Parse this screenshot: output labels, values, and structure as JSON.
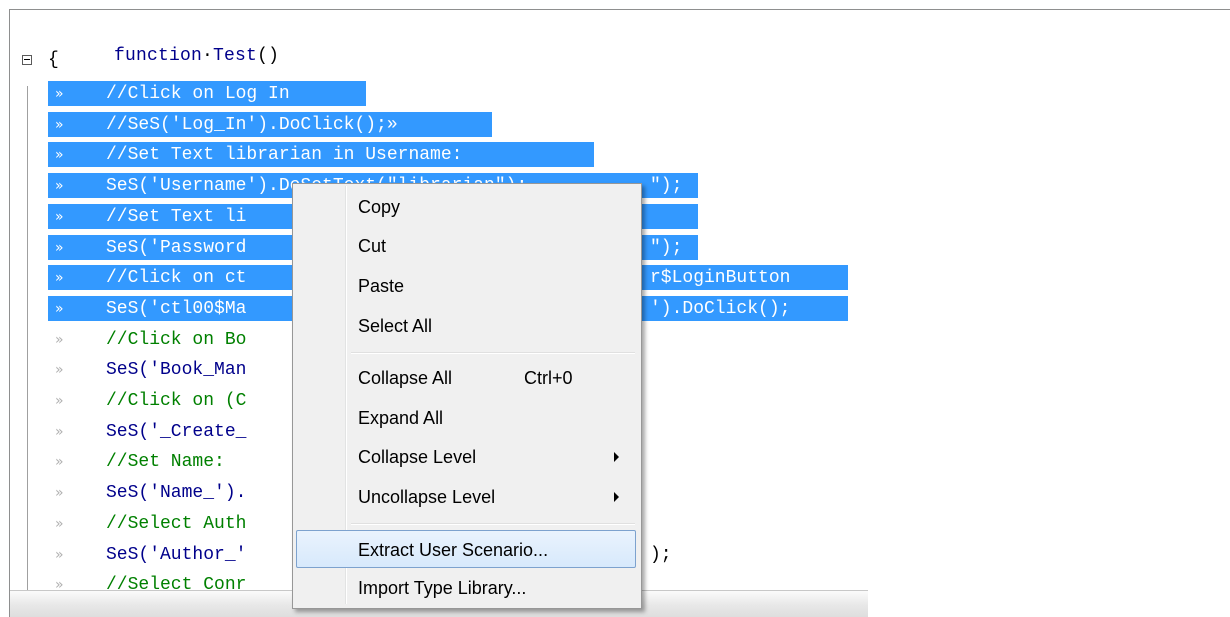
{
  "editor": {
    "header_keyword": "function",
    "header_name": "Test",
    "header_parens": "()",
    "open_brace": "{",
    "lines": [
      {
        "text": "//Click on Log In",
        "type": "cmt",
        "sel": true
      },
      {
        "text": "//SeS('Log_In').DoClick();»",
        "type": "cmt",
        "sel": true
      },
      {
        "text": "//Set Text librarian in Username:",
        "type": "cmt",
        "sel": true
      },
      {
        "text": "SeS('Username').DoSetText(\"librarian\");",
        "type": "code",
        "sel": true
      },
      {
        "text": "//Set Text li",
        "type": "cmt",
        "sel": true
      },
      {
        "text": "SeS('Password",
        "type": "code",
        "sel": true
      },
      {
        "text": "//Click on ct",
        "type": "cmt",
        "sel": true
      },
      {
        "text": "SeS('ctl00$Ma",
        "type": "code",
        "sel": true
      },
      {
        "text": "//Click on Bo",
        "type": "cmt",
        "sel": false
      },
      {
        "text": "SeS('Book_Man",
        "type": "code",
        "sel": false
      },
      {
        "text": "//Click on (C",
        "type": "cmt",
        "sel": false
      },
      {
        "text": "SeS('_Create_",
        "type": "code",
        "sel": false
      },
      {
        "text": "//Set Name:",
        "type": "cmt",
        "sel": false
      },
      {
        "text": "SeS('Name_').",
        "type": "code",
        "sel": false
      },
      {
        "text": "//Select Auth",
        "type": "cmt",
        "sel": false
      },
      {
        "text": "SeS('Author_'",
        "type": "code",
        "sel": false
      },
      {
        "text": "//Select Conr",
        "type": "cmt",
        "sel": false
      }
    ],
    "right_fragments": {
      "line4": "\");",
      "line6": "\");",
      "line7": "r$LoginButton",
      "line8": "').DoClick();",
      "line16": ");"
    },
    "tab_glyph": "»"
  },
  "context_menu": {
    "items": [
      {
        "label": "Copy"
      },
      {
        "label": "Cut"
      },
      {
        "label": "Paste"
      },
      {
        "label": "Select All"
      },
      {
        "label": "Collapse All",
        "shortcut": "Ctrl+0"
      },
      {
        "label": "Expand All"
      },
      {
        "label": "Collapse Level",
        "submenu": true
      },
      {
        "label": "Uncollapse Level",
        "submenu": true
      },
      {
        "label": "Extract User Scenario...",
        "highlighted": true
      },
      {
        "label": "Import Type Library..."
      }
    ]
  },
  "colors": {
    "selection": "#3399ff",
    "comment": "#008000",
    "keyword": "#00008b",
    "string": "#b00040",
    "menu_highlight_border": "#7da2ce"
  }
}
